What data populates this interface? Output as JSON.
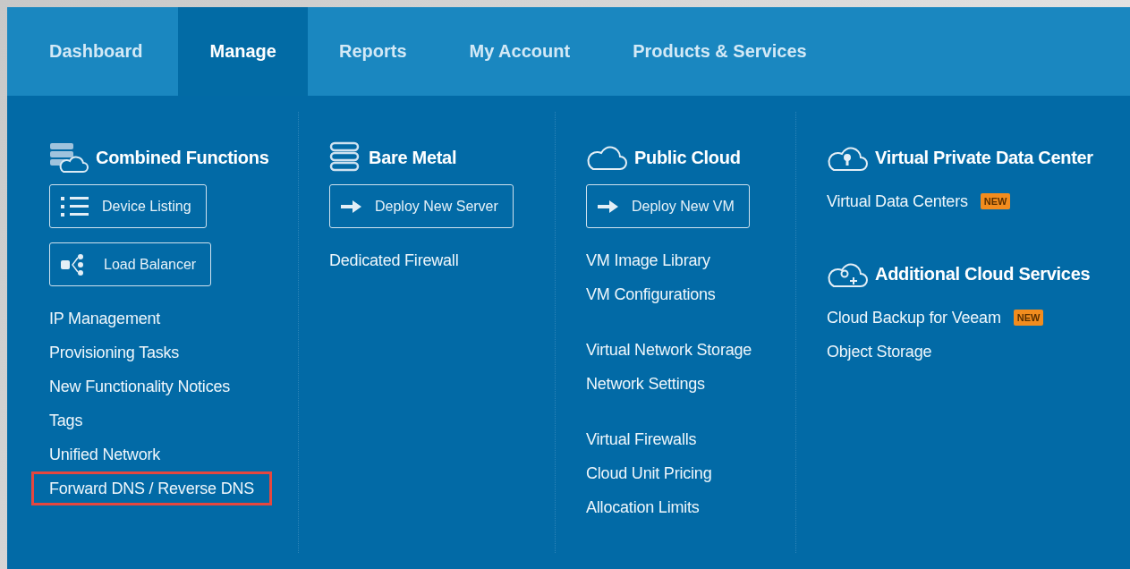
{
  "tabs": [
    {
      "label": "Dashboard",
      "selected": false
    },
    {
      "label": "Manage",
      "selected": true
    },
    {
      "label": "Reports",
      "selected": false
    },
    {
      "label": "My Account",
      "selected": false
    },
    {
      "label": "Products & Services",
      "selected": false
    }
  ],
  "columns": [
    {
      "sections": [
        {
          "heading": {
            "kind": "servers-cloud",
            "label": "Combined Functions"
          },
          "buttons": [
            {
              "kind": "list",
              "label": "Device Listing"
            },
            {
              "kind": "balancer",
              "label": "Load Balancer"
            }
          ],
          "groups": [
            {
              "links": [
                {
                  "label": "IP Management",
                  "highlighted": false
                },
                {
                  "label": "Provisioning Tasks",
                  "highlighted": false
                },
                {
                  "label": "New Functionality Notices",
                  "highlighted": false
                },
                {
                  "label": "Tags",
                  "highlighted": false
                },
                {
                  "label": "Unified Network",
                  "highlighted": false
                },
                {
                  "label": "Forward DNS / Reverse DNS",
                  "highlighted": true
                }
              ]
            }
          ]
        }
      ]
    },
    {
      "sections": [
        {
          "heading": {
            "kind": "servers",
            "label": "Bare Metal"
          },
          "buttons": [
            {
              "kind": "arrow",
              "label": "Deploy New Server"
            }
          ],
          "groups": [
            {
              "links": [
                {
                  "label": "Dedicated Firewall",
                  "highlighted": false
                }
              ]
            }
          ]
        }
      ]
    },
    {
      "sections": [
        {
          "heading": {
            "kind": "cloud",
            "label": "Public Cloud"
          },
          "buttons": [
            {
              "kind": "arrow",
              "label": "Deploy New VM"
            }
          ],
          "groups": [
            {
              "links": [
                {
                  "label": "VM Image Library",
                  "highlighted": false
                },
                {
                  "label": "VM Configurations",
                  "highlighted": false
                }
              ]
            },
            {
              "links": [
                {
                  "label": "Virtual Network Storage",
                  "highlighted": false
                },
                {
                  "label": "Network Settings",
                  "highlighted": false
                }
              ]
            },
            {
              "links": [
                {
                  "label": "Virtual Firewalls",
                  "highlighted": false
                },
                {
                  "label": "Cloud Unit Pricing",
                  "highlighted": false
                },
                {
                  "label": "Allocation Limits",
                  "highlighted": false
                }
              ]
            }
          ]
        }
      ]
    },
    {
      "sections": [
        {
          "heading": {
            "kind": "cloud-lock",
            "label": "Virtual Private Data Center"
          },
          "groups": [
            {
              "links": [
                {
                  "label": "Virtual Data Centers",
                  "highlighted": false,
                  "badge": "NEW"
                }
              ]
            }
          ]
        },
        {
          "heading": {
            "kind": "cloud-gear",
            "label": "Additional Cloud Services"
          },
          "groups": [
            {
              "links": [
                {
                  "label": "Cloud Backup for Veeam",
                  "highlighted": false,
                  "badge": "NEW"
                },
                {
                  "label": "Object Storage",
                  "highlighted": false
                }
              ]
            }
          ]
        }
      ]
    }
  ]
}
